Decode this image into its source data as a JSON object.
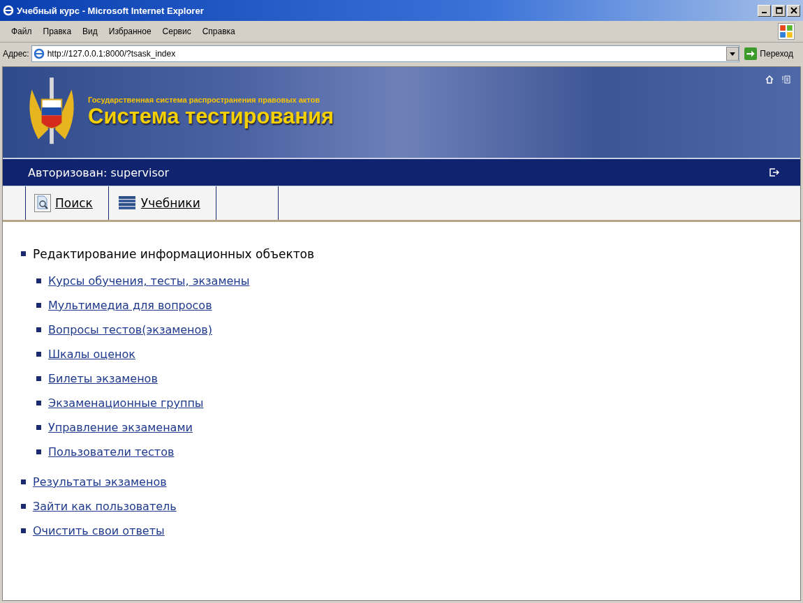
{
  "window": {
    "title": "Учебный курс - Microsoft Internet Explorer"
  },
  "menu_bar": [
    "Файл",
    "Правка",
    "Вид",
    "Избранное",
    "Сервис",
    "Справка"
  ],
  "address_bar": {
    "label": "Адрес:",
    "value": "http://127.0.0.1:8000/?tsask_index",
    "go_button": "Переход"
  },
  "header": {
    "subtitle": "Государственная система распространения правовых актов",
    "title": "Система тестирования"
  },
  "auth_bar": {
    "text": "Авторизован: supervisor"
  },
  "toolbar": [
    {
      "kind": "search",
      "label": "Поиск"
    },
    {
      "kind": "books",
      "label": "Учебники"
    }
  ],
  "menu": [
    {
      "label": "Редактирование информационных объектов",
      "link": false,
      "children": [
        {
          "label": "Курсы обучения, тесты, экзамены",
          "link": true
        },
        {
          "label": "Мультимедиа для вопросов",
          "link": true
        },
        {
          "label": "Вопросы тестов(экзаменов)",
          "link": true
        },
        {
          "label": "Шкалы оценок",
          "link": true
        },
        {
          "label": "Билеты экзаменов",
          "link": true
        },
        {
          "label": "Экзаменационные группы",
          "link": true
        },
        {
          "label": "Управление экзаменами",
          "link": true
        },
        {
          "label": "Пользователи тестов",
          "link": true
        }
      ]
    },
    {
      "label": "Результаты экзаменов",
      "link": true
    },
    {
      "label": "Зайти как пользователь",
      "link": true
    },
    {
      "label": "Очистить свои ответы",
      "link": true
    }
  ]
}
